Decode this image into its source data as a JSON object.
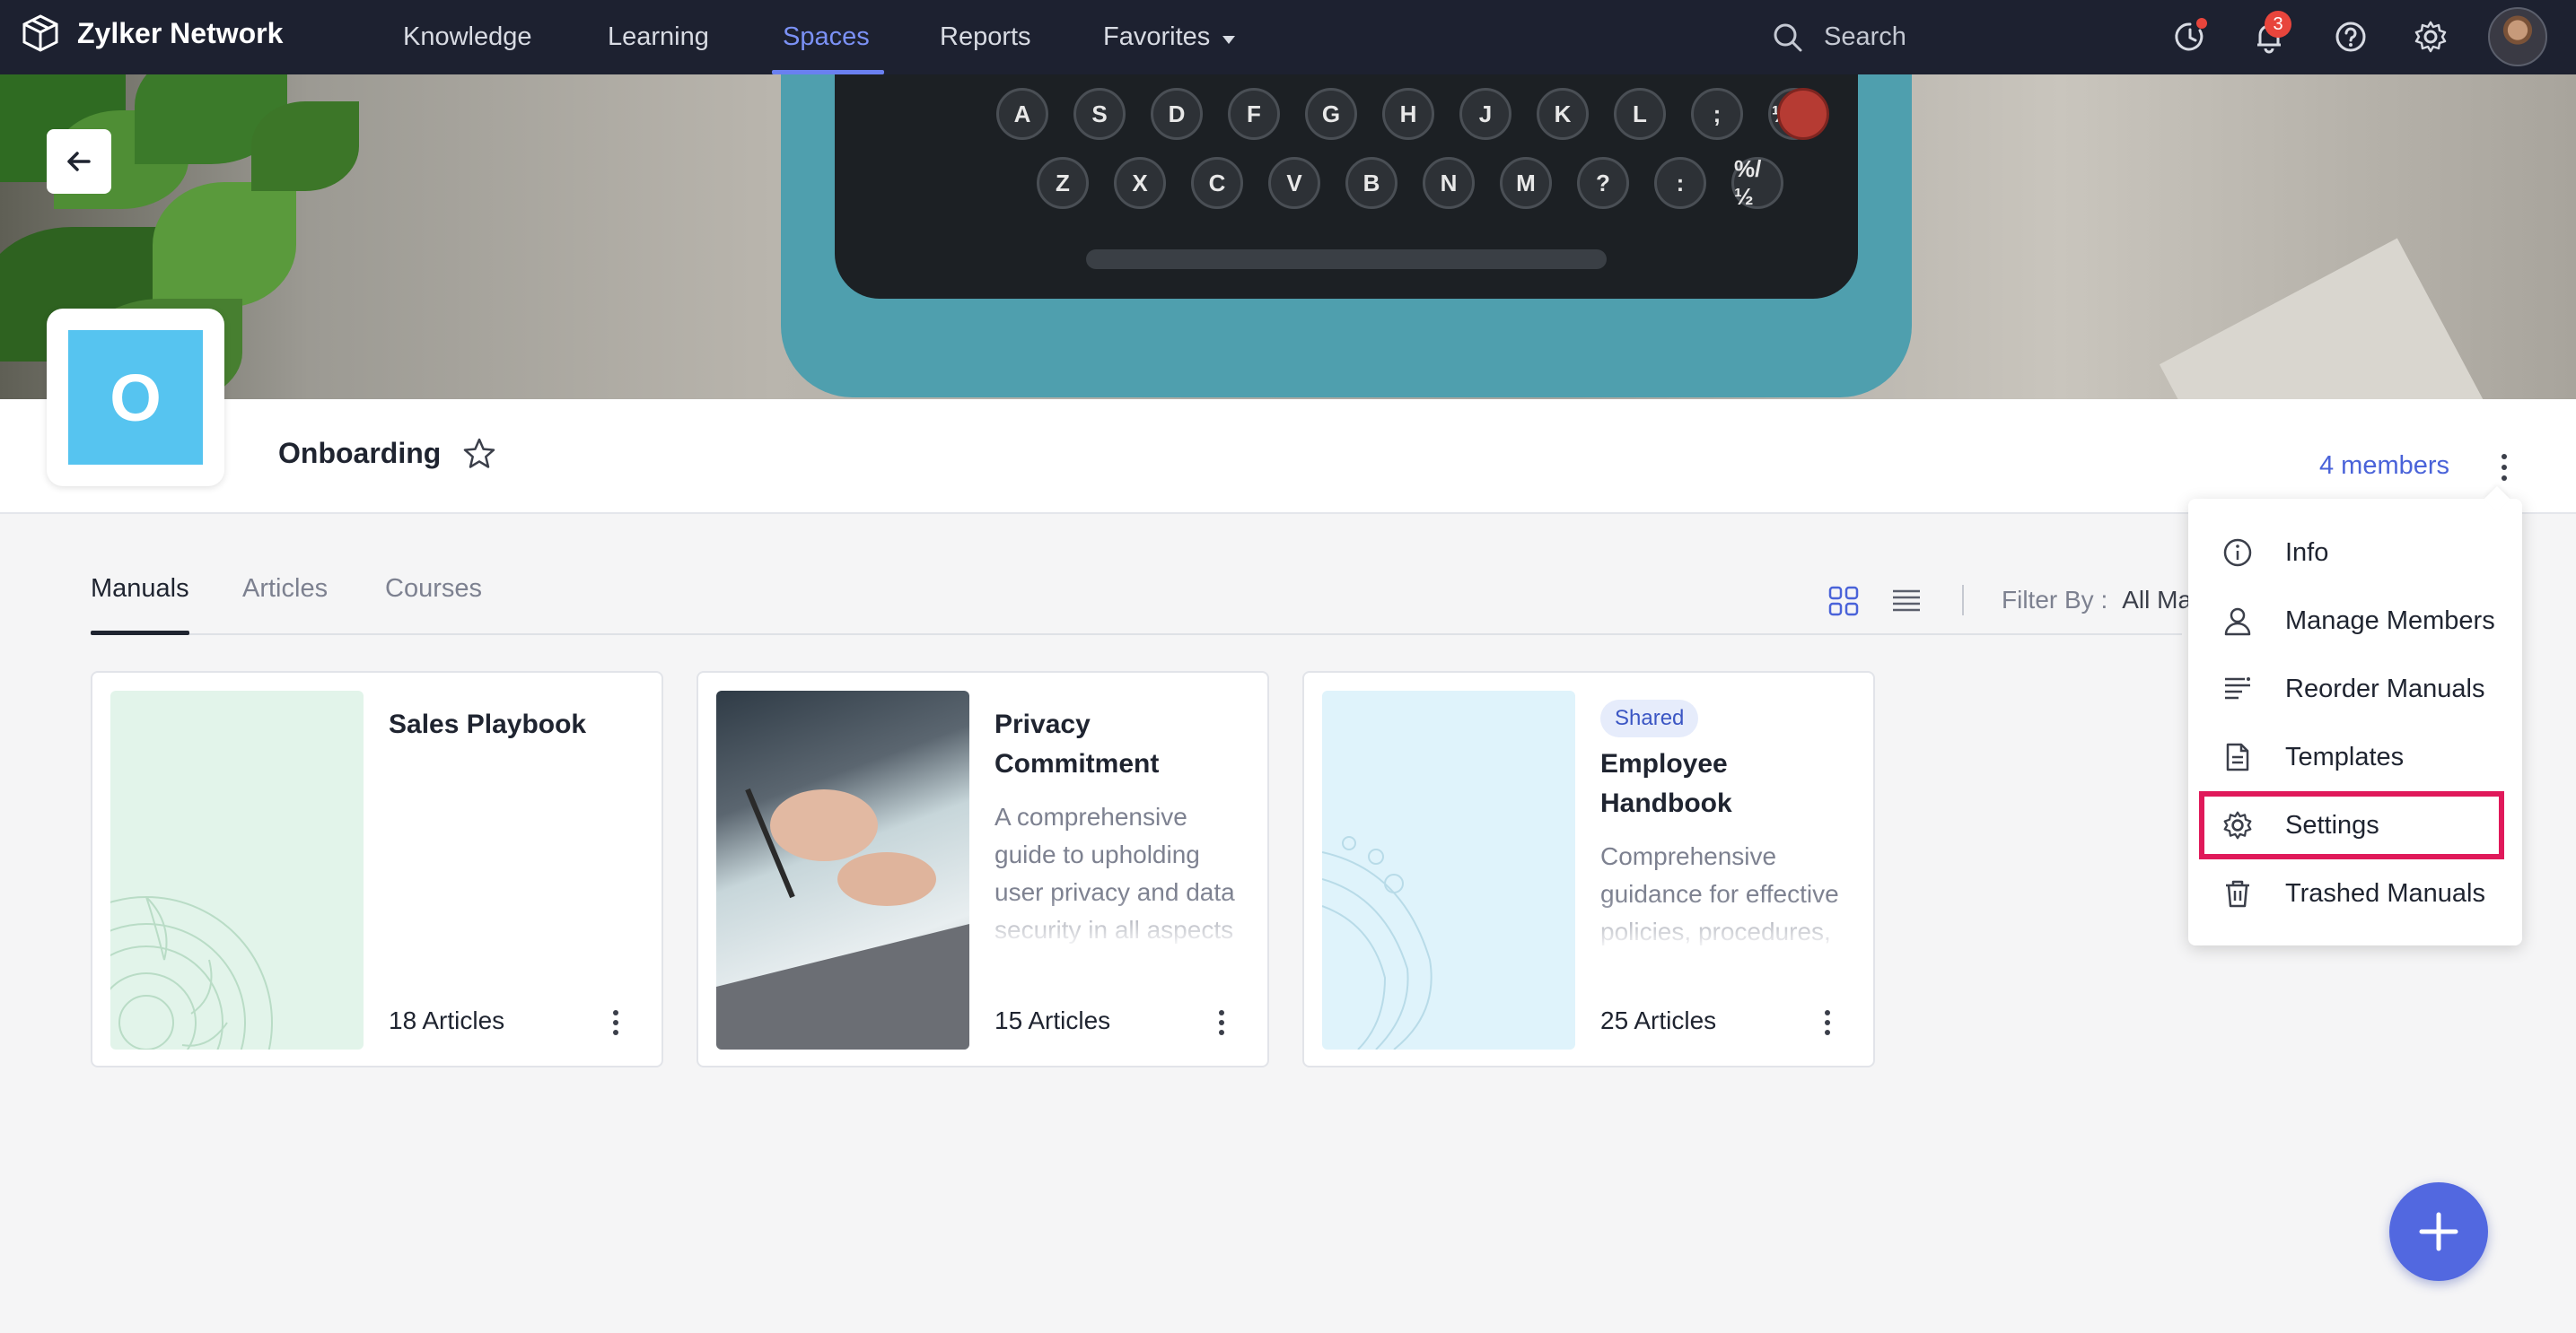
{
  "topnav": {
    "brand": "Zylker Network",
    "items": [
      {
        "label": "Knowledge"
      },
      {
        "label": "Learning"
      },
      {
        "label": "Spaces",
        "active": true
      },
      {
        "label": "Reports"
      },
      {
        "label": "Favorites"
      }
    ],
    "search_placeholder": "Search",
    "notification_count": "3",
    "icons": [
      "history-icon",
      "bell-icon",
      "help-icon",
      "gear-icon",
      "avatar"
    ]
  },
  "space": {
    "logo_letter": "O",
    "title": "Onboarding",
    "members_link": "4 members"
  },
  "banner": {
    "keys_row1": [
      "A",
      "S",
      "D",
      "F",
      "G",
      "H",
      "J",
      "K",
      "L",
      ";",
      "⅓/⅔"
    ],
    "keys_row2": [
      "Z",
      "X",
      "C",
      "V",
      "B",
      "N",
      "M",
      "?",
      ":",
      "%/½"
    ]
  },
  "tabs": [
    {
      "label": "Manuals",
      "active": true
    },
    {
      "label": "Articles"
    },
    {
      "label": "Courses"
    }
  ],
  "toolbar": {
    "filter_label": "Filter By :",
    "filter_value": "All Ma"
  },
  "manuals": [
    {
      "title": "Sales Playbook",
      "description": "",
      "count": "18 Articles",
      "badge": "",
      "cover": "mandala-green"
    },
    {
      "title": "Privacy Commitment",
      "description": "A comprehensive guide to upholding user privacy and data security in all aspects",
      "count": "15 Articles",
      "badge": "",
      "cover": "photo-signing"
    },
    {
      "title": "Employee Handbook",
      "description": "Comprehensive guidance for effective policies, procedures,",
      "count": "25 Articles",
      "badge": "Shared",
      "cover": "mandala-blue"
    }
  ],
  "menu": {
    "items": [
      {
        "label": "Info",
        "icon": "info-icon"
      },
      {
        "label": "Manage Members",
        "icon": "user-icon"
      },
      {
        "label": "Reorder Manuals",
        "icon": "reorder-icon"
      },
      {
        "label": "Templates",
        "icon": "template-icon"
      },
      {
        "label": "Settings",
        "icon": "gear-icon",
        "highlighted": true
      },
      {
        "label": "Trashed Manuals",
        "icon": "trash-icon"
      }
    ]
  },
  "colors": {
    "nav_bg": "#1d2130",
    "accent": "#5268e0",
    "highlight_border": "#e0195a",
    "logo_tile": "#56c4f0"
  }
}
